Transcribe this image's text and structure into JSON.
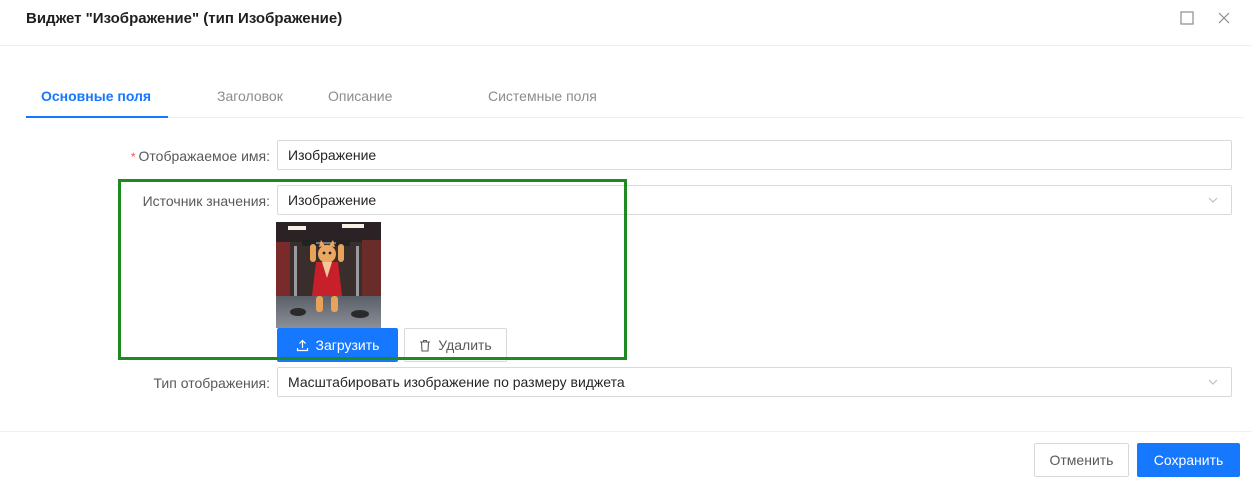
{
  "dialog": {
    "title": "Виджет \"Изображение\" (тип Изображение)",
    "maximize_icon": "square-icon",
    "close_icon": "close-icon"
  },
  "tabs": [
    {
      "label": "Основные поля",
      "active": true
    },
    {
      "label": "Заголовок",
      "active": false
    },
    {
      "label": "Описание",
      "active": false
    },
    {
      "label": "Системные поля",
      "active": false
    }
  ],
  "form": {
    "display_name": {
      "required_mark": "*",
      "label": "Отображаемое имя:",
      "value": "Изображение"
    },
    "value_source": {
      "label": "Источник значения:",
      "value": "Изображение",
      "upload_label": "Загрузить",
      "delete_label": "Удалить"
    },
    "display_type": {
      "label": "Тип отображения:",
      "value": "Масштабировать изображение по размеру виджета"
    }
  },
  "footer": {
    "cancel_label": "Отменить",
    "save_label": "Сохранить"
  },
  "colors": {
    "accent": "#1677ff",
    "highlight_border": "#1f8a1f",
    "required": "#ff4d4f"
  }
}
